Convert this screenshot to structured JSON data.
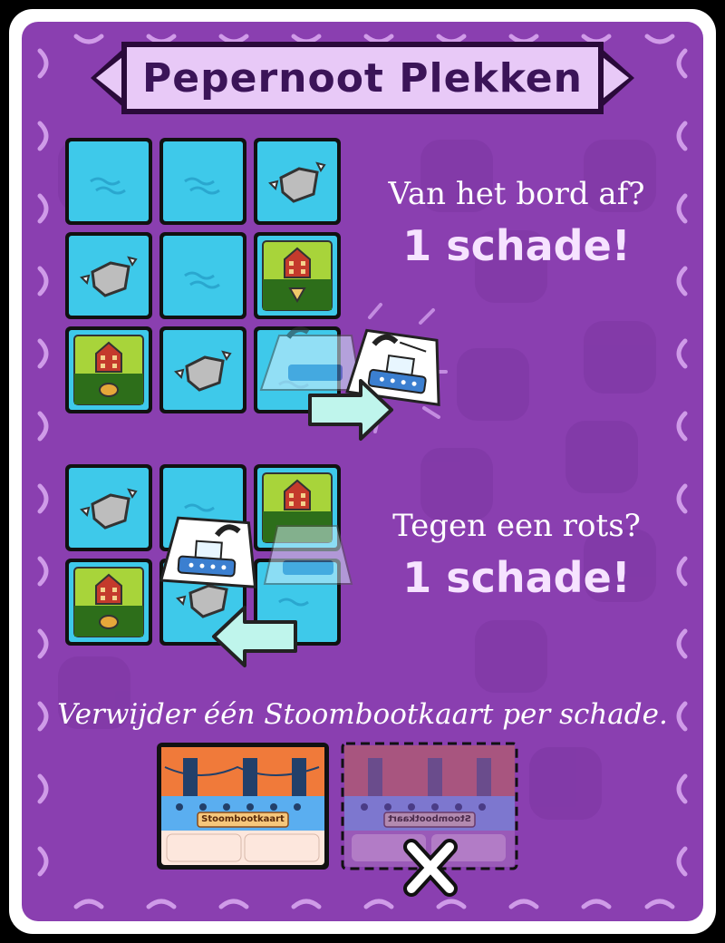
{
  "title": "Pepernoot Plekken",
  "rules": [
    {
      "question": "Van het bord af?",
      "damage": "1 schade!"
    },
    {
      "question": "Tegen een rots?",
      "damage": "1 schade!"
    }
  ],
  "footer": "Verwijder één Stoombootkaart per schade.",
  "card_labels": {
    "steamboat_card": "Stoombootkaart",
    "steamboat_card_flipped": "Stoombootkaart"
  },
  "discard_mark": "X",
  "colors": {
    "panel": "#8a3fb0",
    "banner": "#e8c9f7",
    "water": "#3ec9ea",
    "land": "#a8d43a",
    "rock": "#bdbdbd",
    "house": "#c43a2c",
    "card_top": "#f07a3a",
    "card_ship": "#5aaef0"
  }
}
